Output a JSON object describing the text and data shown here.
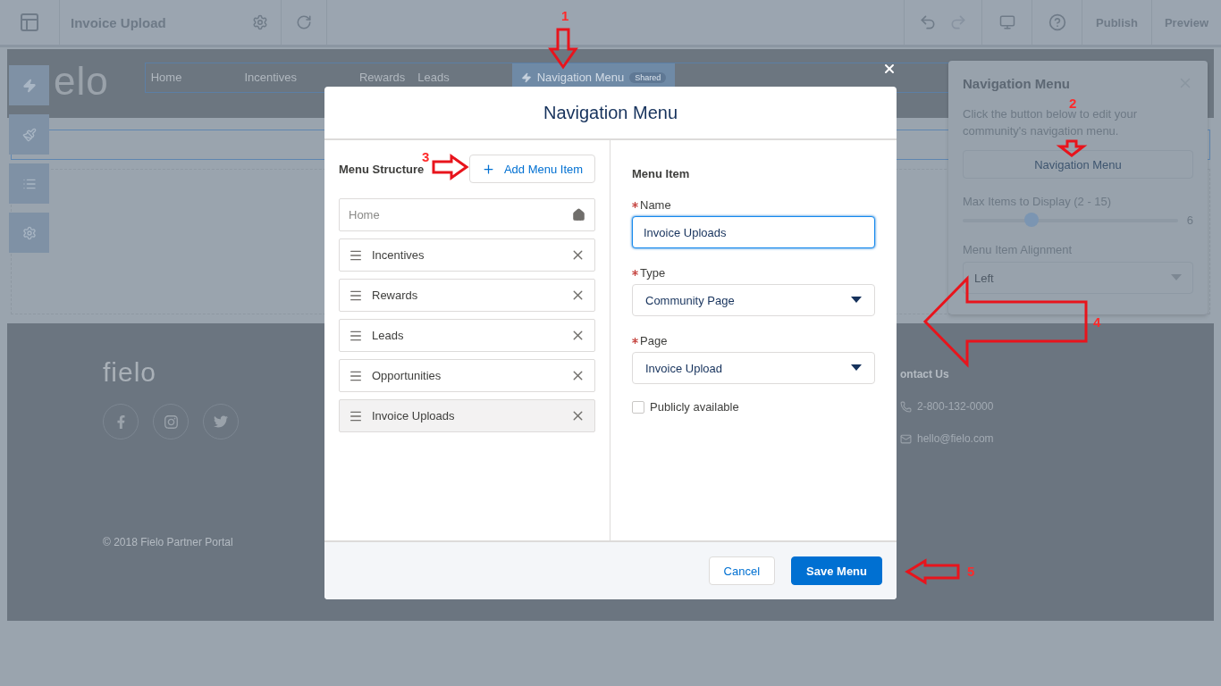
{
  "toolbar": {
    "page_title": "Invoice Upload",
    "actions": [
      "Publish",
      "Preview"
    ]
  },
  "site_header": {
    "logo": "elo",
    "nav": [
      {
        "label": "Home",
        "selected": false
      },
      {
        "label": "Incentives",
        "selected": false
      },
      {
        "label": "Rewards",
        "selected": false
      },
      {
        "label": "Leads",
        "selected": false
      },
      {
        "label": "Navigation Menu",
        "selected": true,
        "badge": "Shared"
      }
    ]
  },
  "footer": {
    "logo": "fielo",
    "contact_heading": "ontact Us",
    "phone": "2-800-132-0000",
    "email": "hello@fielo.com",
    "copyright": "© 2018 Fielo Partner Portal"
  },
  "property_panel": {
    "title": "Navigation Menu",
    "description": "Click the button below to edit your community's navigation menu.",
    "button": "Navigation Menu",
    "slider": {
      "label": "Max Items to Display (2 - 15)",
      "level": 0.32,
      "reading": "6"
    },
    "alignment": {
      "label": "Menu Item Alignment",
      "value": "Left"
    }
  },
  "modal": {
    "title": "Navigation Menu",
    "structure_heading": "Menu Structure",
    "add_button": "Add Menu Item",
    "items": [
      {
        "label": "Home",
        "kind": "home",
        "selected": false
      },
      {
        "label": "Incentives",
        "kind": "item",
        "selected": false
      },
      {
        "label": "Rewards",
        "kind": "item",
        "selected": false
      },
      {
        "label": "Leads",
        "kind": "item",
        "selected": false
      },
      {
        "label": "Opportunities",
        "kind": "item",
        "selected": false
      },
      {
        "label": "Invoice Uploads",
        "kind": "item",
        "selected": true
      }
    ],
    "detail_heading": "Menu Item",
    "fields": [
      {
        "label": "Name",
        "kind": "text",
        "required": true,
        "value": "Invoice Uploads",
        "focused": true
      },
      {
        "label": "Type",
        "kind": "select",
        "required": true,
        "value": "Community Page",
        "focused": false
      },
      {
        "label": "Page",
        "kind": "select",
        "required": true,
        "value": "Invoice Upload",
        "focused": false
      }
    ],
    "checkbox": {
      "label": "Publicly available",
      "checked": false
    },
    "buttons": [
      "Cancel",
      "Save Menu"
    ]
  },
  "annotations": [
    "1",
    "2",
    "3",
    "4",
    "5"
  ]
}
